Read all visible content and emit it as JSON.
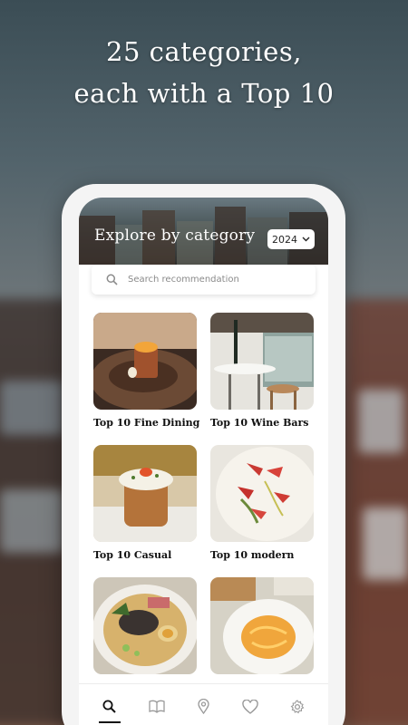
{
  "headline": {
    "line1": "25 categories,",
    "line2": "each with a Top 10"
  },
  "app": {
    "header_title": "Explore by category",
    "year_selected": "2024",
    "search_placeholder": "Search recommendation",
    "categories": [
      {
        "label": "Top 10 Fine Dining"
      },
      {
        "label": "Top 10 Wine Bars"
      },
      {
        "label": "Top 10 Casual"
      },
      {
        "label": "Top 10 modern"
      },
      {
        "label": ""
      },
      {
        "label": ""
      }
    ],
    "tabs": [
      {
        "icon": "search-icon",
        "active": true
      },
      {
        "icon": "book-icon",
        "active": false
      },
      {
        "icon": "location-pin-icon",
        "active": false
      },
      {
        "icon": "heart-icon",
        "active": false
      },
      {
        "icon": "gear-icon",
        "active": false
      }
    ]
  },
  "colors": {
    "accent": "#111111",
    "inactive_icon": "#9a9a9a"
  }
}
